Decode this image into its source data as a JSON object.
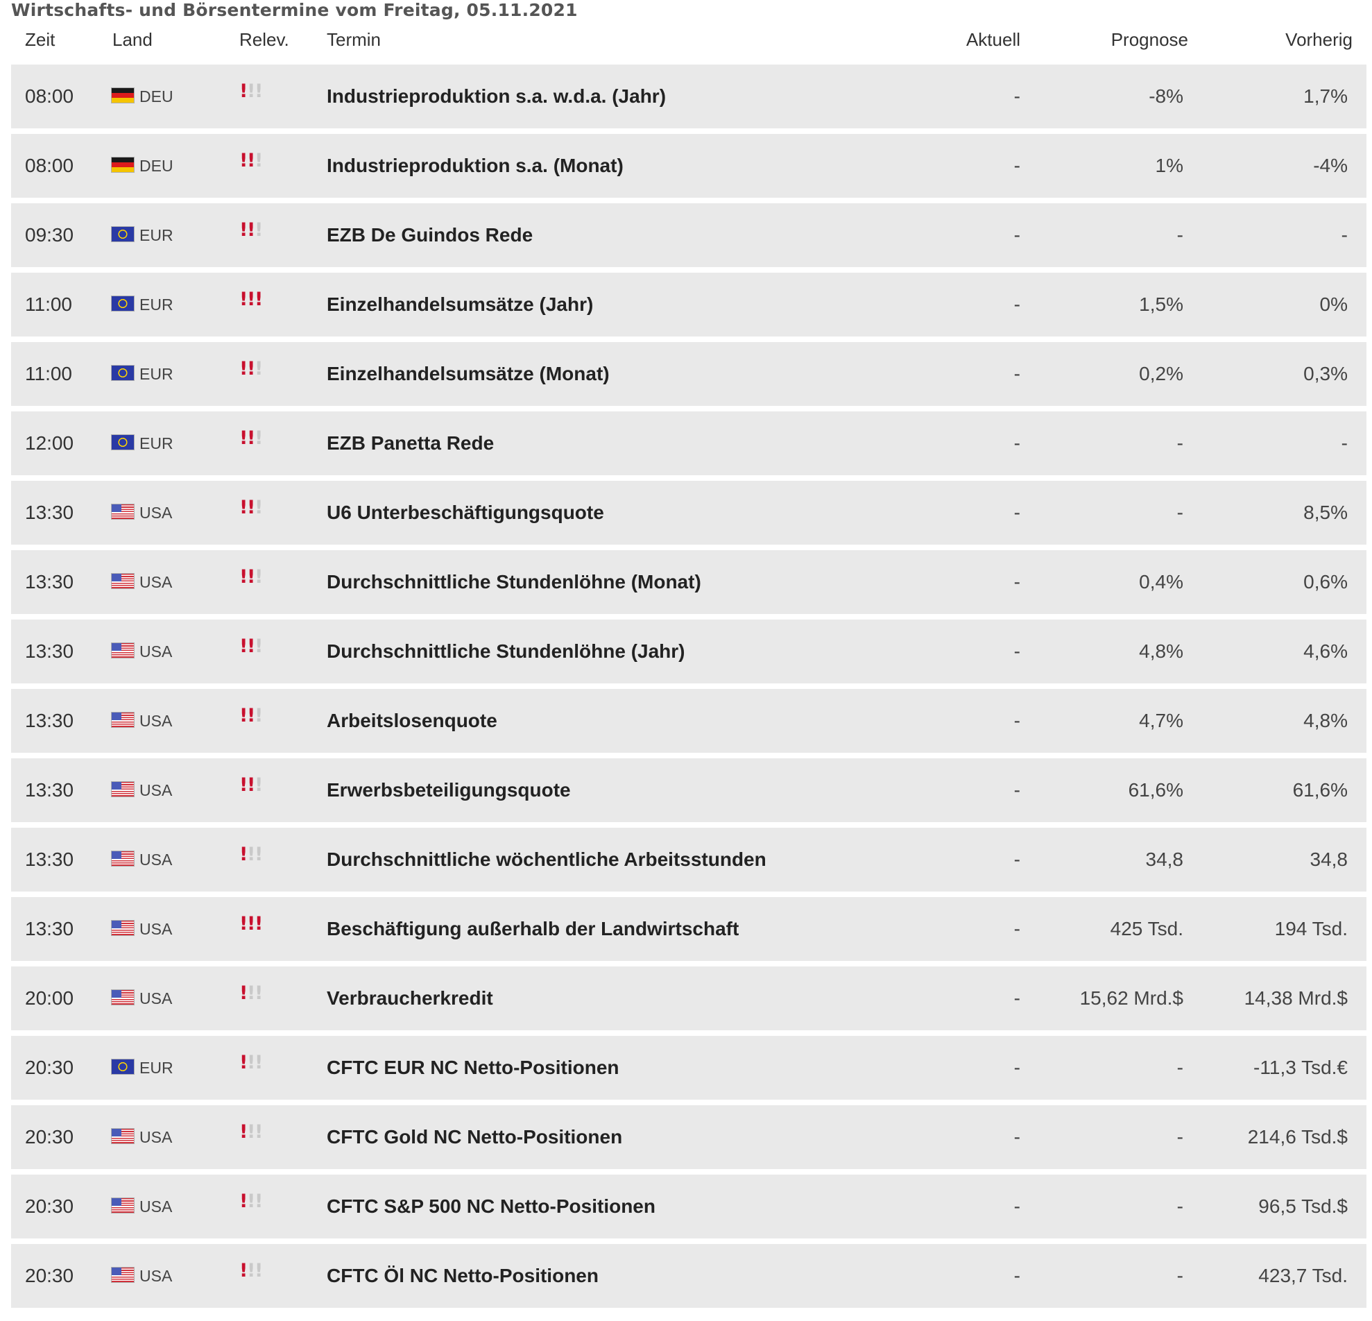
{
  "page": {
    "title": "Wirtschafts- und Börsentermine vom Freitag, 05.11.2021"
  },
  "headers": {
    "zeit": "Zeit",
    "land": "Land",
    "relev": "Relev.",
    "termin": "Termin",
    "aktuell": "Aktuell",
    "prognose": "Prognose",
    "vorherig": "Vorherig"
  },
  "icons": {
    "relevance_mark": "exclamation-icon",
    "active_color": "#c8102e",
    "inactive_color": "#c9c9c9"
  },
  "rows": [
    {
      "time": "08:00",
      "flag": "deu",
      "land": "DEU",
      "relevance": 1,
      "termin": "Industrieproduktion s.a. w.d.a. (Jahr)",
      "aktuell": "-",
      "prognose": "-8%",
      "vorherig": "1,7%"
    },
    {
      "time": "08:00",
      "flag": "deu",
      "land": "DEU",
      "relevance": 2,
      "termin": "Industrieproduktion s.a. (Monat)",
      "aktuell": "-",
      "prognose": "1%",
      "vorherig": "-4%"
    },
    {
      "time": "09:30",
      "flag": "eur",
      "land": "EUR",
      "relevance": 2,
      "termin": "EZB De Guindos Rede",
      "aktuell": "-",
      "prognose": "-",
      "vorherig": "-"
    },
    {
      "time": "11:00",
      "flag": "eur",
      "land": "EUR",
      "relevance": 3,
      "termin": "Einzelhandelsumsätze (Jahr)",
      "aktuell": "-",
      "prognose": "1,5%",
      "vorherig": "0%"
    },
    {
      "time": "11:00",
      "flag": "eur",
      "land": "EUR",
      "relevance": 2,
      "termin": "Einzelhandelsumsätze (Monat)",
      "aktuell": "-",
      "prognose": "0,2%",
      "vorherig": "0,3%"
    },
    {
      "time": "12:00",
      "flag": "eur",
      "land": "EUR",
      "relevance": 2,
      "termin": "EZB Panetta Rede",
      "aktuell": "-",
      "prognose": "-",
      "vorherig": "-"
    },
    {
      "time": "13:30",
      "flag": "usa",
      "land": "USA",
      "relevance": 2,
      "termin": "U6 Unterbeschäftigungsquote",
      "aktuell": "-",
      "prognose": "-",
      "vorherig": "8,5%"
    },
    {
      "time": "13:30",
      "flag": "usa",
      "land": "USA",
      "relevance": 2,
      "termin": "Durchschnittliche Stundenlöhne (Monat)",
      "aktuell": "-",
      "prognose": "0,4%",
      "vorherig": "0,6%"
    },
    {
      "time": "13:30",
      "flag": "usa",
      "land": "USA",
      "relevance": 2,
      "termin": "Durchschnittliche Stundenlöhne (Jahr)",
      "aktuell": "-",
      "prognose": "4,8%",
      "vorherig": "4,6%"
    },
    {
      "time": "13:30",
      "flag": "usa",
      "land": "USA",
      "relevance": 2,
      "termin": "Arbeitslosenquote",
      "aktuell": "-",
      "prognose": "4,7%",
      "vorherig": "4,8%"
    },
    {
      "time": "13:30",
      "flag": "usa",
      "land": "USA",
      "relevance": 2,
      "termin": "Erwerbsbeteiligungsquote",
      "aktuell": "-",
      "prognose": "61,6%",
      "vorherig": "61,6%"
    },
    {
      "time": "13:30",
      "flag": "usa",
      "land": "USA",
      "relevance": 1,
      "termin": "Durchschnittliche wöchentliche Arbeitsstunden",
      "aktuell": "-",
      "prognose": "34,8",
      "vorherig": "34,8"
    },
    {
      "time": "13:30",
      "flag": "usa",
      "land": "USA",
      "relevance": 3,
      "termin": "Beschäftigung außerhalb der Landwirtschaft",
      "aktuell": "-",
      "prognose": "425 Tsd.",
      "vorherig": "194 Tsd."
    },
    {
      "time": "20:00",
      "flag": "usa",
      "land": "USA",
      "relevance": 1,
      "termin": "Verbraucherkredit",
      "aktuell": "-",
      "prognose": "15,62 Mrd.$",
      "vorherig": "14,38 Mrd.$"
    },
    {
      "time": "20:30",
      "flag": "eur",
      "land": "EUR",
      "relevance": 1,
      "termin": "CFTC EUR NC Netto-Positionen",
      "aktuell": "-",
      "prognose": "-",
      "vorherig": "-11,3 Tsd.€"
    },
    {
      "time": "20:30",
      "flag": "usa",
      "land": "USA",
      "relevance": 1,
      "termin": "CFTC Gold NC Netto-Positionen",
      "aktuell": "-",
      "prognose": "-",
      "vorherig": "214,6 Tsd.$"
    },
    {
      "time": "20:30",
      "flag": "usa",
      "land": "USA",
      "relevance": 1,
      "termin": "CFTC S&P 500 NC Netto-Positionen",
      "aktuell": "-",
      "prognose": "-",
      "vorherig": "96,5 Tsd.$"
    },
    {
      "time": "20:30",
      "flag": "usa",
      "land": "USA",
      "relevance": 1,
      "termin": "CFTC Öl NC Netto-Positionen",
      "aktuell": "-",
      "prognose": "-",
      "vorherig": "423,7 Tsd."
    }
  ]
}
